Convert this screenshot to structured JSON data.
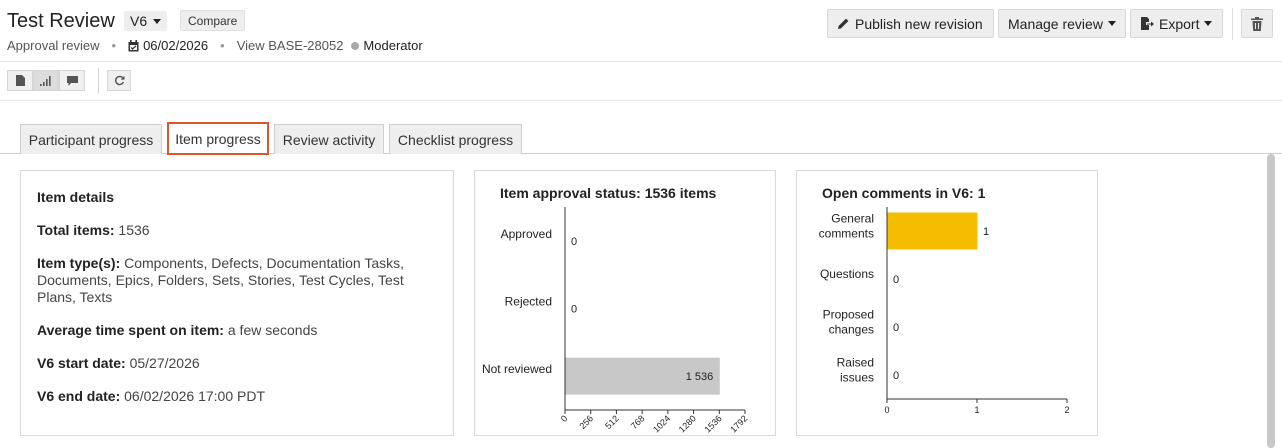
{
  "header": {
    "title": "Test Review",
    "version": "V6",
    "compare_label": "Compare",
    "review_type": "Approval review",
    "date": "06/02/2026",
    "view_label": "View BASE-28052",
    "role": "Moderator",
    "buttons": {
      "publish": "Publish new revision",
      "manage": "Manage review",
      "export": "Export"
    }
  },
  "tabs": [
    "Participant progress",
    "Item progress",
    "Review activity",
    "Checklist progress"
  ],
  "active_tab": "Item progress",
  "details": {
    "heading": "Item details",
    "total_label": "Total items:",
    "total_value": "1536",
    "types_label": "Item type(s):",
    "types_value": "Components, Defects, Documentation Tasks, Documents, Epics, Folders, Sets, Stories, Test Cycles, Test Plans, Texts",
    "avg_label": "Average time spent on item:",
    "avg_value": "a few seconds",
    "start_label": "V6 start date:",
    "start_value": "05/27/2026",
    "end_label": "V6 end date:",
    "end_value": "06/02/2026 17:00 PDT"
  },
  "chart_data": [
    {
      "type": "bar",
      "orientation": "horizontal",
      "title": "Item approval status: 1536 items",
      "categories": [
        "Approved",
        "Rejected",
        "Not reviewed"
      ],
      "values": [
        0,
        0,
        1536
      ],
      "value_labels": [
        "0",
        "0",
        "1 536"
      ],
      "xlim": [
        0,
        1792
      ],
      "xticks": [
        "0",
        "256",
        "512",
        "768",
        "1024",
        "1280",
        "1536",
        "1792"
      ],
      "colors": [
        "#c8c8c8",
        "#c8c8c8",
        "#c8c8c8"
      ]
    },
    {
      "type": "bar",
      "orientation": "horizontal",
      "title": "Open comments in V6: 1",
      "categories": [
        [
          "General",
          "comments"
        ],
        [
          "Questions"
        ],
        [
          "Proposed",
          "changes"
        ],
        [
          "Raised",
          "issues"
        ]
      ],
      "values": [
        1,
        0,
        0,
        0
      ],
      "value_labels": [
        "1",
        "0",
        "0",
        "0"
      ],
      "xlim": [
        0,
        2
      ],
      "xticks": [
        "0",
        "1",
        "2"
      ],
      "colors": [
        "#f5bc00",
        "#f5bc00",
        "#f5bc00",
        "#f5bc00"
      ]
    }
  ]
}
